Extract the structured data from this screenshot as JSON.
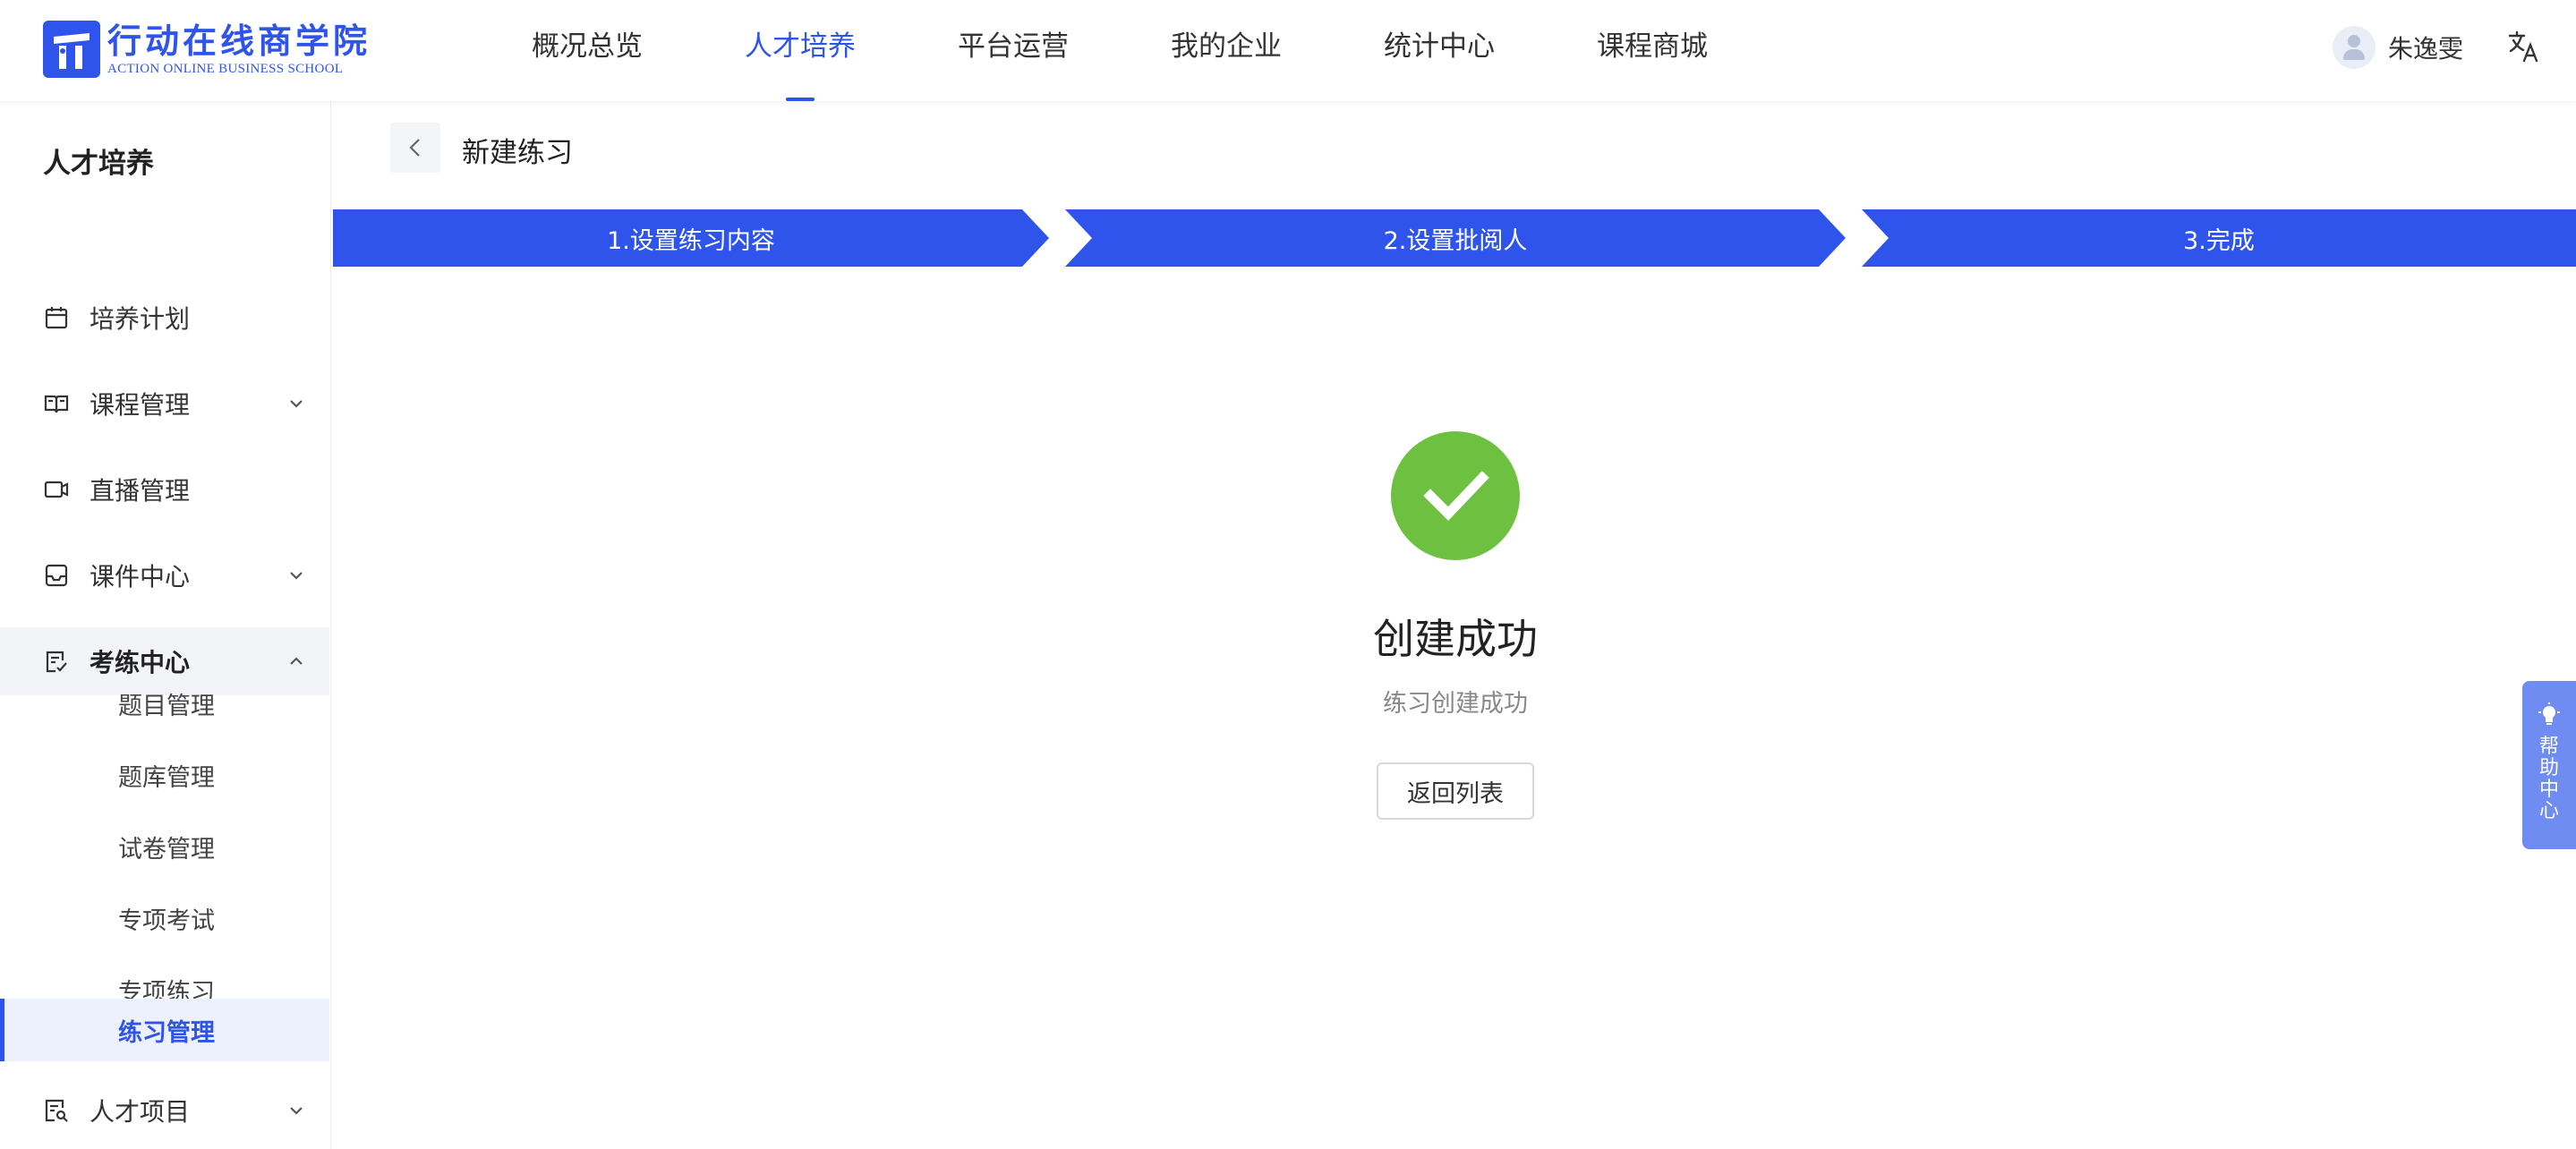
{
  "header": {
    "logo_cn": "行动在线商学院",
    "logo_en": "ACTION ONLINE BUSINESS SCHOOL",
    "nav": [
      "概况总览",
      "人才培养",
      "平台运营",
      "我的企业",
      "统计中心",
      "课程商城"
    ],
    "active_nav": "人才培养",
    "user_name": "朱逸雯"
  },
  "sidebar": {
    "title": "人才培养",
    "items": [
      {
        "label": "培养计划",
        "icon": "calendar-icon"
      },
      {
        "label": "课程管理",
        "icon": "book-icon"
      },
      {
        "label": "直播管理",
        "icon": "video-icon"
      },
      {
        "label": "课件中心",
        "icon": "inbox-icon"
      },
      {
        "label": "考练中心",
        "icon": "exam-icon"
      },
      {
        "label": "人才项目",
        "icon": "project-icon"
      }
    ],
    "sub_items": [
      "题目管理",
      "题库管理",
      "试卷管理",
      "专项考试",
      "专项练习",
      "练习管理"
    ],
    "active_sub": "练习管理"
  },
  "main": {
    "page_title": "新建练习",
    "steps": [
      "1.设置练习内容",
      "2.设置批阅人",
      "3.完成"
    ],
    "result_title": "创建成功",
    "result_sub": "练习创建成功",
    "return_button": "返回列表"
  },
  "help": {
    "label": "帮助中心"
  },
  "colors": {
    "primary": "#2f54eb",
    "success": "#6ec041",
    "help": "#6f8cf2"
  }
}
